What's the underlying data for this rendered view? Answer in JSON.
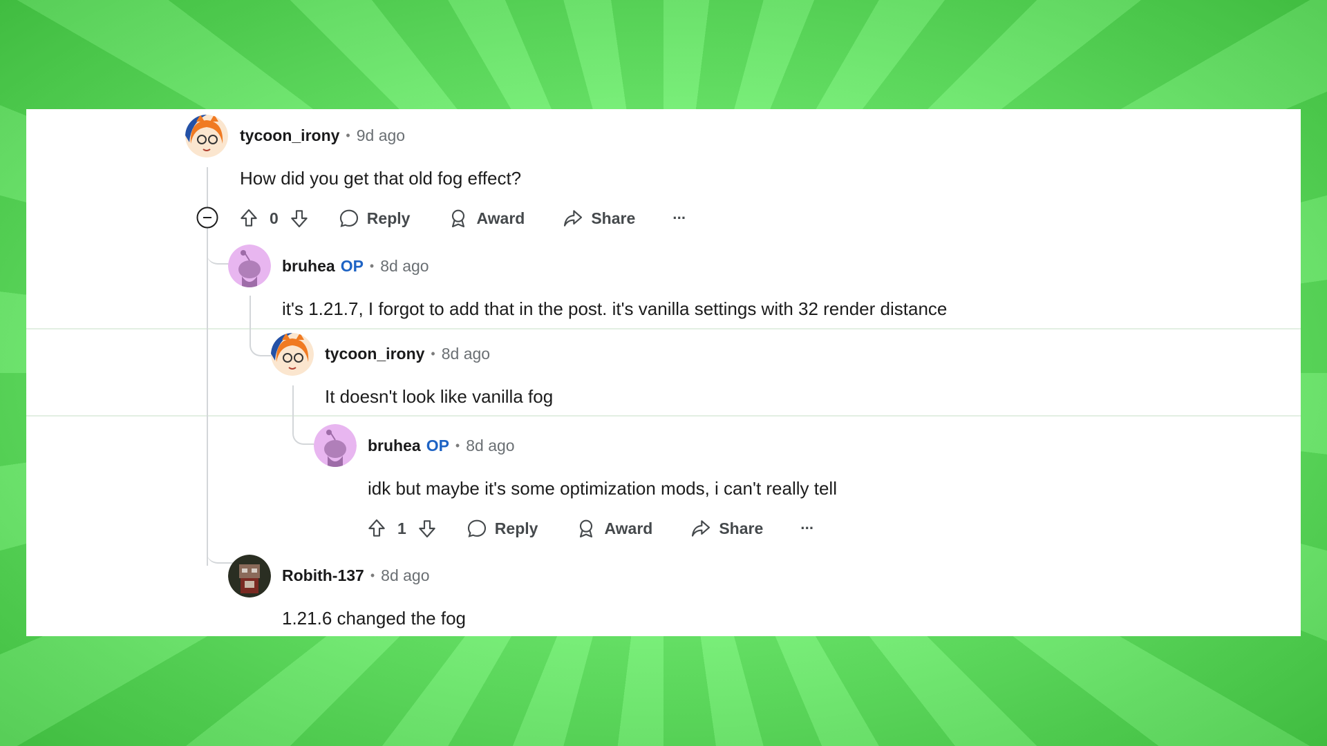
{
  "colors": {
    "op_badge": "#1e63c4",
    "meta_gray": "#6a6f73",
    "thread_line": "#d3d6d9"
  },
  "comments": [
    {
      "username": "tycoon_irony",
      "time": "9d ago",
      "body": "How did you get that old fog effect?",
      "avatar_icon": "anime-girl-avatar-icon",
      "actions": {
        "votes": "0",
        "reply": "Reply",
        "award": "Award",
        "share": "Share",
        "more": "···"
      }
    },
    {
      "username": "bruhea",
      "op": "OP",
      "time": "8d ago",
      "body": "it's 1.21.7, I forgot to add that in the post. it's vanilla settings with 32 render distance",
      "avatar_icon": "snoo-avatar-icon"
    },
    {
      "username": "tycoon_irony",
      "time": "8d ago",
      "body": "It doesn't look like vanilla fog",
      "avatar_icon": "anime-girl-avatar-icon"
    },
    {
      "username": "bruhea",
      "op": "OP",
      "time": "8d ago",
      "body": "idk but maybe it's some optimization mods, i can't really tell",
      "avatar_icon": "snoo-avatar-icon",
      "actions": {
        "votes": "1",
        "reply": "Reply",
        "award": "Award",
        "share": "Share",
        "more": "···"
      }
    },
    {
      "username": "Robith-137",
      "time": "8d ago",
      "body": "1.21.6 changed the fog",
      "avatar_icon": "pixel-character-avatar-icon"
    }
  ],
  "separator": "•"
}
